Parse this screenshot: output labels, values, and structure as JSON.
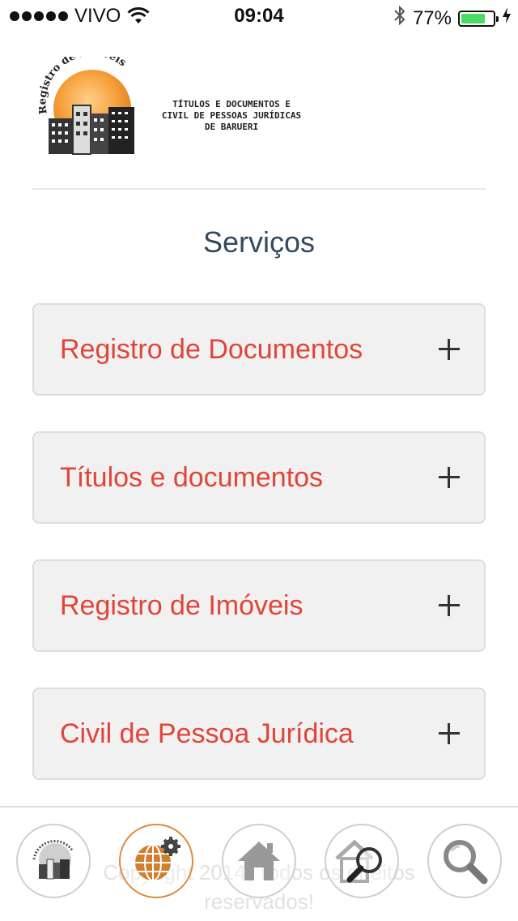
{
  "status_bar": {
    "carrier": "VIVO",
    "time": "09:04",
    "battery_percent": "77%",
    "battery_level": 0.77,
    "icons": [
      "signal-dots-icon",
      "wifi-icon",
      "bluetooth-icon",
      "battery-icon",
      "charging-bolt-icon"
    ]
  },
  "logo": {
    "arc_text": "Registro de Imóveis",
    "line1": "TÍTULOS E DOCUMENTOS E",
    "line2": "CIVIL DE PESSOAS JURÍDICAS",
    "line3": "DE BARUERI"
  },
  "page": {
    "title": "Serviços"
  },
  "services": [
    {
      "label": "Registro de Documentos",
      "icon": "plus-icon"
    },
    {
      "label": "Títulos e documentos",
      "icon": "plus-icon"
    },
    {
      "label": "Registro de Imóveis",
      "icon": "plus-icon"
    },
    {
      "label": "Civil de Pessoa Jurídica",
      "icon": "plus-icon"
    }
  ],
  "footer": {
    "copyright_line1": "Copyright 2014. Todos os direitos",
    "copyright_line2": "reservados!",
    "nav": [
      {
        "name": "logo-nav-icon",
        "active": false
      },
      {
        "name": "services-globe-icon",
        "active": true
      },
      {
        "name": "home-icon",
        "active": false
      },
      {
        "name": "property-search-icon",
        "active": false
      },
      {
        "name": "search-icon",
        "active": false
      }
    ]
  },
  "colors": {
    "accent_red": "#e0453a",
    "title_slate": "#34495e",
    "active_orange": "#e08a3a",
    "battery_green": "#4cd964"
  }
}
